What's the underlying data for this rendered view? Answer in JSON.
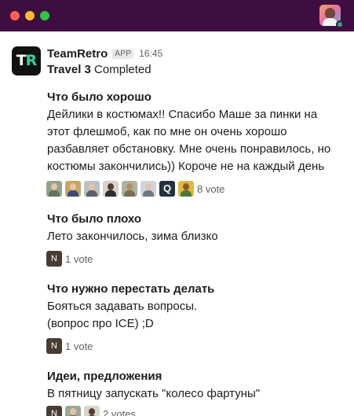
{
  "window": {
    "controls": [
      "close",
      "minimize",
      "maximize"
    ]
  },
  "message": {
    "sender": "TeamRetro",
    "app_logo_text": [
      "T",
      "R"
    ],
    "badge": "APP",
    "time": "16:45",
    "subtitle_bold": "Travel 3",
    "subtitle_rest": " Completed"
  },
  "sections": [
    {
      "title": "Что было хорошо",
      "lines": [
        "Дейлики в костюмах!! Спасибо Маше за пинки на",
        "этот флешмоб, как по мне он очень хорошо",
        "разбавляет обстановку. Мне очень понравилось, но",
        "костюмы закончились)) Короче не на каждый день"
      ],
      "votes": "8 vote"
    },
    {
      "title": "Что было плохо",
      "lines": [
        "Лето закончилось, зима близко"
      ],
      "voter_letter": "N",
      "votes": "1 vote"
    },
    {
      "title": "Что нужно перестать делать",
      "lines": [
        "Бояться задавать вопросы.",
        "(вопрос про ICE) ;D"
      ],
      "voter_letter": "N",
      "votes": "1 vote"
    },
    {
      "title": "Идеи, предложения",
      "lines": [
        "В пятницу запускать \"колесо фартуны\""
      ],
      "voter_letter": "N",
      "votes": "2 votes"
    }
  ],
  "colors": {
    "titlebar": "#3f0e40",
    "accent_green": "#31d59a",
    "presence": "#2bac76"
  }
}
